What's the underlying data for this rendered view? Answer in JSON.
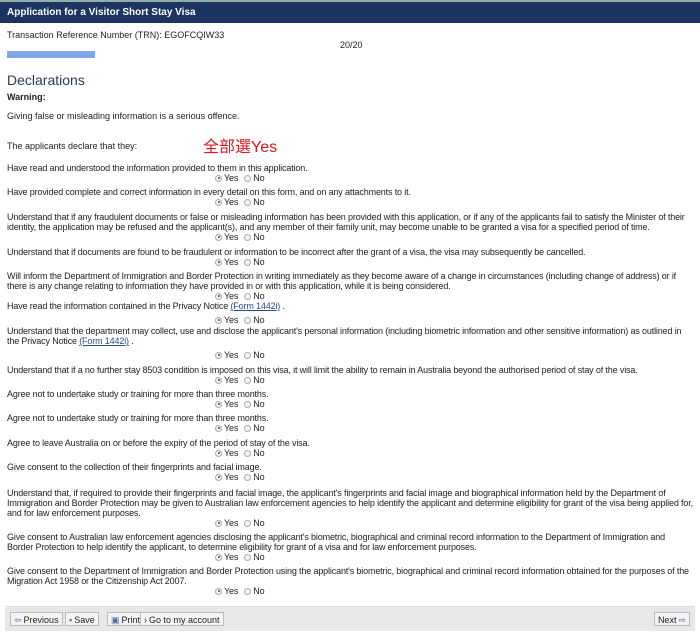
{
  "header": {
    "title": "Application for a Visitor Short Stay Visa"
  },
  "trn": "Transaction Reference Number (TRN): EGOFCQIW33",
  "progress": {
    "label": "20/20",
    "value": 1.0,
    "color": "#7ea7e8"
  },
  "page_title": "Declarations",
  "warning_label": "Warning:",
  "warning_text": "Giving false or misleading information is a serious offence.",
  "intro": "The applicants declare that they:",
  "annotation": "全部選Yes",
  "yes": "Yes",
  "no": "No",
  "questions": [
    {
      "text": "Have read and understood the information provided to them in this application.",
      "answer": "Yes"
    },
    {
      "text": "Have provided complete and correct information in every detail on this form, and on any attachments to it.",
      "answer": "Yes"
    },
    {
      "text": "Understand that if any fraudulent documents or false or misleading information has been provided with this application, or if any of the applicants fail to satisfy the Minister of their identity, the application may be refused and the applicant(s), and any member of their family unit, may become unable to be granted a visa for a specified period of time.",
      "answer": "Yes"
    },
    {
      "text": "Understand that if documents are found to be fraudulent or information to be incorrect after the grant of a visa, the visa may subsequently be cancelled.",
      "answer": "Yes"
    },
    {
      "text": "Will inform the Department of Immigration and Border Protection in writing immediately as they become aware of a change in circumstances (including change of address) or if there is any change relating to information they have provided in or with this application, while it is being considered.",
      "answer": "Yes"
    },
    {
      "text": "Have read the information contained in the Privacy Notice ",
      "link": "(Form 1442i)",
      "suffix": " .",
      "answer": "Yes"
    },
    {
      "text": "Understand that the department may collect, use and disclose the applicant's personal information (including biometric information and other sensitive information) as outlined in the Privacy Notice ",
      "link": "(Form 1442i)",
      "suffix": " .",
      "answer": "Yes"
    },
    {
      "text": "Understand that if a no further stay 8503 condition is imposed on this visa, it will limit the ability to remain in Australia beyond the authorised period of stay of the visa.",
      "answer": "Yes"
    },
    {
      "text": "Agree not to undertake study or training for more than three months.",
      "answer": "Yes"
    },
    {
      "text": "Agree not to undertake study or training for more than three months.",
      "answer": "Yes"
    },
    {
      "text": "Agree to leave Australia on or before the expiry of the period of stay of the visa.",
      "answer": "Yes"
    },
    {
      "text": "Give consent to the collection of their fingerprints and facial image.",
      "answer": "Yes"
    },
    {
      "text": "Understand that, if required to provide their fingerprints and facial image, the applicant's fingerprints and facial image and biographical information held by the Department of Immigration and Border Protection may be given to Australian law enforcement agencies to help identify the applicant and determine eligibility for grant of the visa being applied for, and for law enforcement purposes.",
      "answer": "Yes"
    },
    {
      "text": "Give consent to Australian law enforcement agencies disclosing the applicant's biometric, biographical and criminal record information to the Department of Immigration and Border Protection to help identify the applicant, to determine eligibility for grant of a visa and for law enforcement purposes.",
      "answer": "Yes"
    },
    {
      "text": "Give consent to the Department of Immigration and Border Protection using the applicant's biometric, biographical and criminal record information obtained for the purposes of the Migration Act 1958 or the Citizenship Act 2007.",
      "answer": "Yes"
    }
  ],
  "footer": {
    "previous": "Previous",
    "save": "Save",
    "print": "Print",
    "account": "Go to my account",
    "next": "Next"
  }
}
